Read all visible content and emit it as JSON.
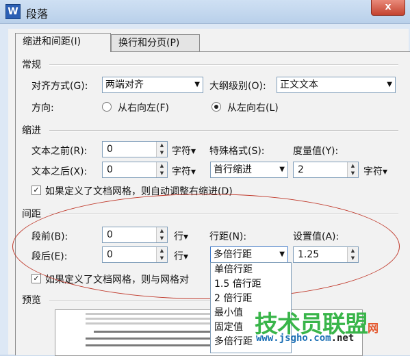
{
  "window": {
    "title": "段落",
    "app_icon": "W",
    "close_symbol": "x"
  },
  "tabs": [
    {
      "label": "缩进和间距(I)"
    },
    {
      "label": "换行和分页(P)"
    }
  ],
  "general": {
    "heading": "常规",
    "alignment_label": "对齐方式(G):",
    "alignment_value": "两端对齐",
    "outline_label": "大纲级别(O):",
    "outline_value": "正文文本",
    "direction_label": "方向:",
    "rtl_label": "从右向左(F)",
    "ltr_label": "从左向右(L)"
  },
  "indent": {
    "heading": "缩进",
    "before_label": "文本之前(R):",
    "before_value": "0",
    "before_unit": "字符▾",
    "after_label": "文本之后(X):",
    "after_value": "0",
    "after_unit": "字符▾",
    "special_label": "特殊格式(S):",
    "special_value": "首行缩进",
    "measure_label": "度量值(Y):",
    "measure_value": "2",
    "measure_unit": "字符▾",
    "grid_check": "如果定义了文档网格，则自动调整右缩进(D)"
  },
  "spacing": {
    "heading": "间距",
    "before_label": "段前(B):",
    "before_value": "0",
    "before_unit": "行▾",
    "after_label": "段后(E):",
    "after_value": "0",
    "after_unit": "行▾",
    "line_label": "行距(N):",
    "line_value": "多倍行距",
    "setting_label": "设置值(A):",
    "setting_value": "1.25",
    "grid_check": "如果定义了文档网格，则与网格对",
    "line_options": [
      "单倍行距",
      "1.5 倍行距",
      "2 倍行距",
      "最小值",
      "固定值",
      "多倍行距"
    ]
  },
  "preview": {
    "heading": "预览"
  },
  "watermark": {
    "brand": "技术员联盟",
    "suffix": "网",
    "url": "www.jsgho.com",
    "tld": ".net"
  },
  "colors": {
    "annotation": "#c0392b",
    "watermark_green": "#39b54a",
    "watermark_blue": "#1b6fb5"
  }
}
